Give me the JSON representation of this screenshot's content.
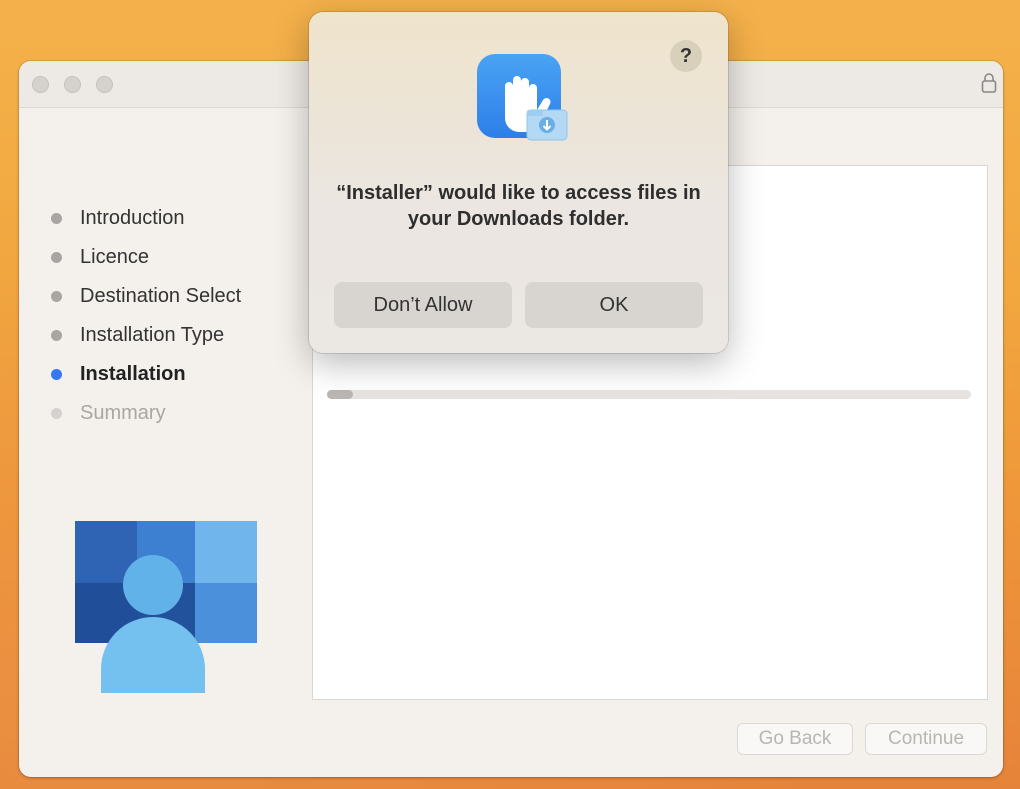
{
  "installer": {
    "steps": [
      {
        "label": "Introduction",
        "state": "done"
      },
      {
        "label": "Licence",
        "state": "done"
      },
      {
        "label": "Destination Select",
        "state": "done"
      },
      {
        "label": "Installation Type",
        "state": "done"
      },
      {
        "label": "Installation",
        "state": "active"
      },
      {
        "label": "Summary",
        "state": "future"
      }
    ],
    "progress_fraction": 0.04,
    "buttons": {
      "back": "Go Back",
      "continue": "Continue"
    },
    "icons": {
      "lock": "lock-icon",
      "logo": "company-portal-logo"
    }
  },
  "dialog": {
    "message": "“Installer” would like to access files in your Downloads folder.",
    "help": "?",
    "deny_label": "Don’t Allow",
    "ok_label": "OK",
    "icon": "privacy-hand-folder-icon"
  },
  "colors": {
    "accent": "#3478f6",
    "wallpaper": "#f2a83f",
    "window_bg": "#f4f0ec"
  }
}
